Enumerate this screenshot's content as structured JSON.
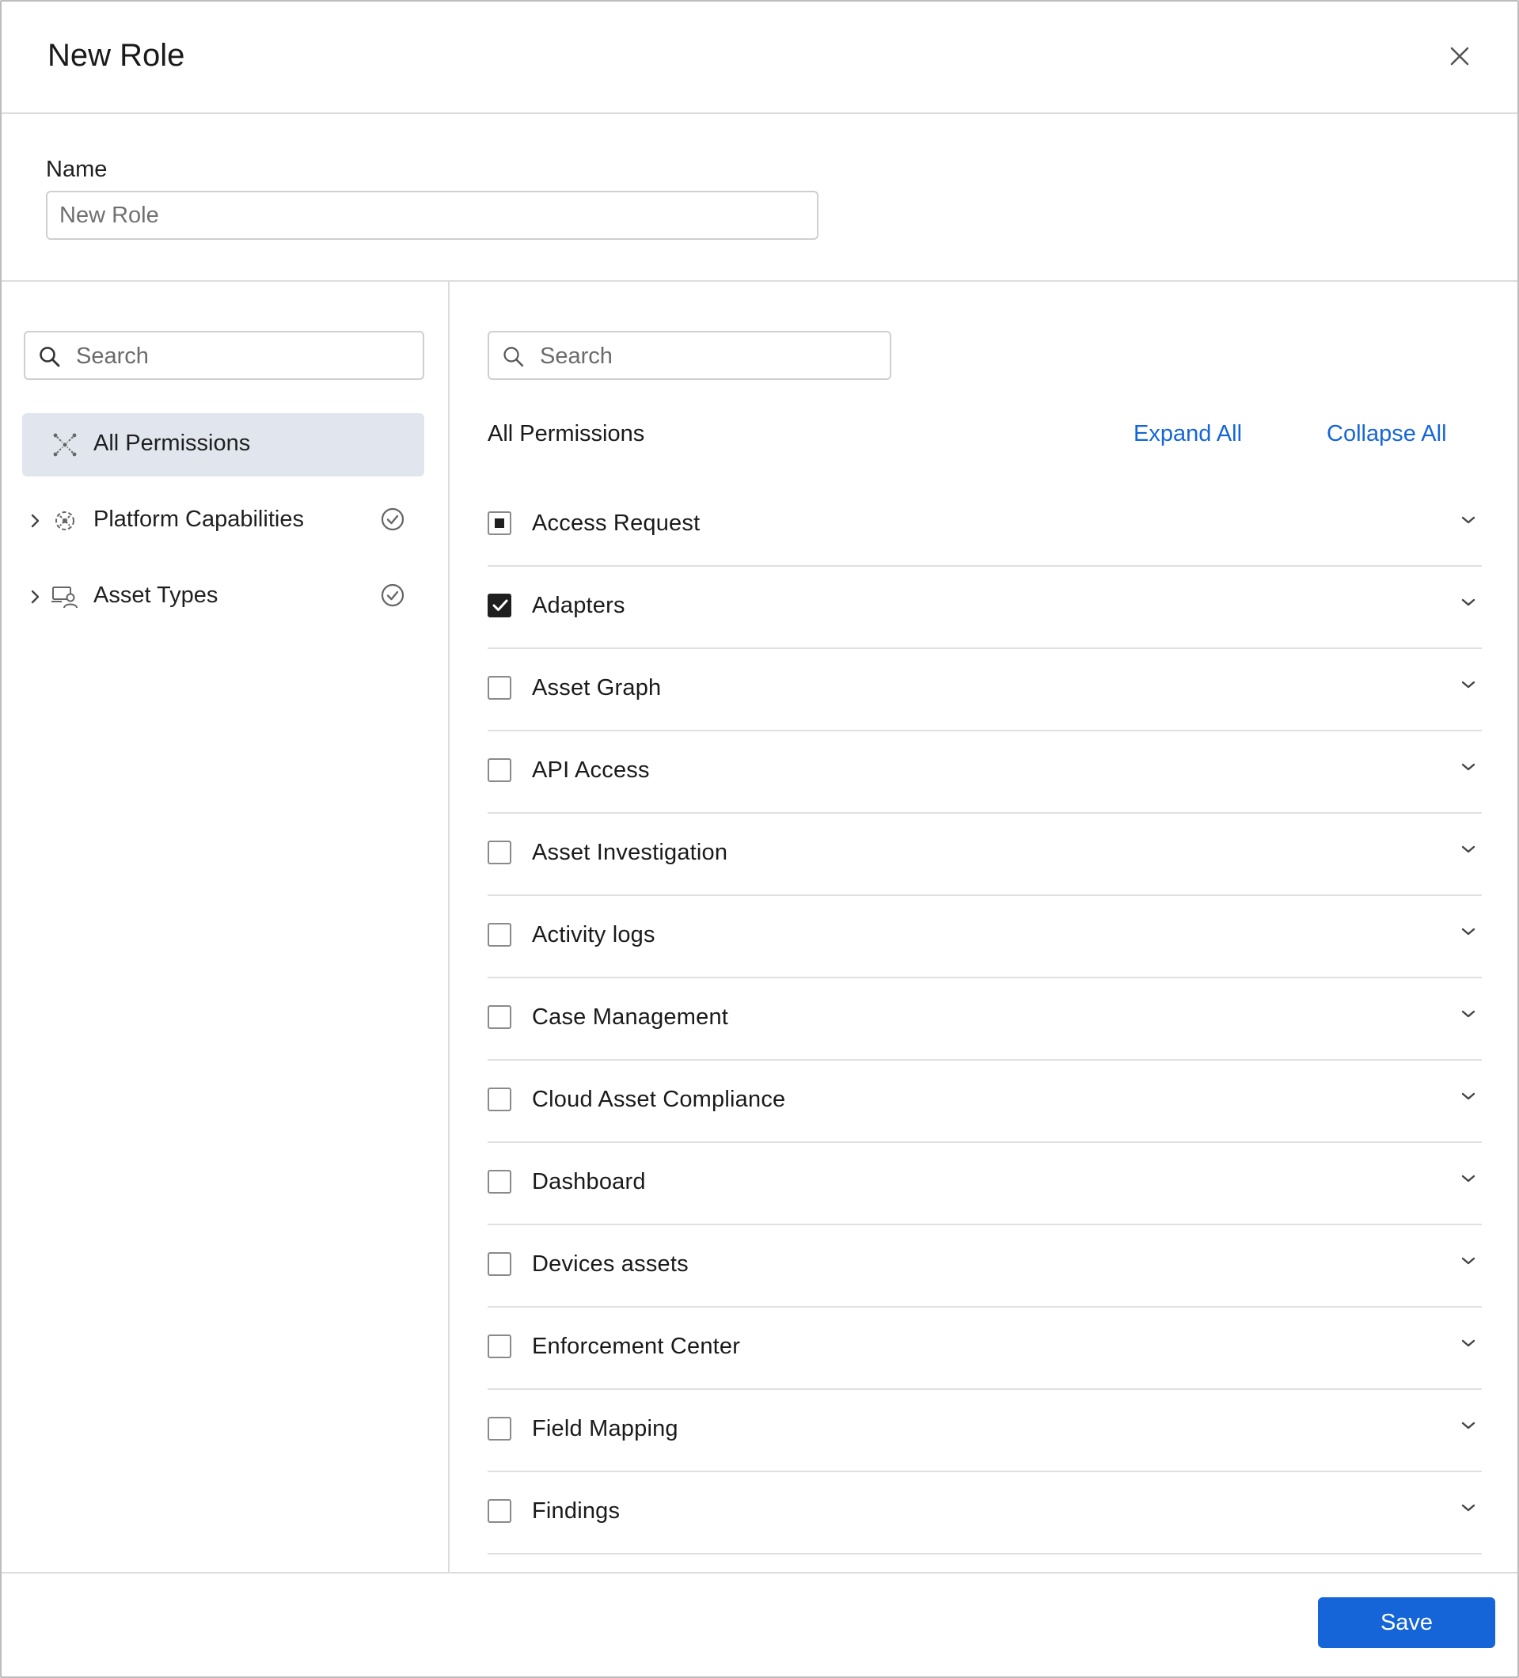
{
  "dialog": {
    "title": "New Role",
    "close_icon": "close-icon"
  },
  "name_field": {
    "label": "Name",
    "placeholder": "New Role",
    "value": ""
  },
  "left_panel": {
    "search_placeholder": "Search",
    "tree": [
      {
        "label": "All Permissions",
        "icon": "all-permissions-icon",
        "selected": true,
        "expandable": false,
        "status_icon": ""
      },
      {
        "label": "Platform Capabilities",
        "icon": "platform-capabilities-icon",
        "selected": false,
        "expandable": true,
        "status_icon": "check-circle-icon"
      },
      {
        "label": "Asset Types",
        "icon": "asset-types-icon",
        "selected": false,
        "expandable": true,
        "status_icon": "check-circle-icon"
      }
    ]
  },
  "right_panel": {
    "search_placeholder": "Search",
    "heading": "All Permissions",
    "expand_all": "Expand All",
    "collapse_all": "Collapse All",
    "permissions": [
      {
        "label": "Access Request",
        "state": "partial"
      },
      {
        "label": "Adapters",
        "state": "checked"
      },
      {
        "label": "Asset Graph",
        "state": "unchecked"
      },
      {
        "label": "API Access",
        "state": "unchecked"
      },
      {
        "label": "Asset Investigation",
        "state": "unchecked"
      },
      {
        "label": "Activity logs",
        "state": "unchecked"
      },
      {
        "label": "Case Management",
        "state": "unchecked"
      },
      {
        "label": "Cloud Asset Compliance",
        "state": "unchecked"
      },
      {
        "label": "Dashboard",
        "state": "unchecked"
      },
      {
        "label": "Devices assets",
        "state": "unchecked"
      },
      {
        "label": "Enforcement Center",
        "state": "unchecked"
      },
      {
        "label": "Field Mapping",
        "state": "unchecked"
      },
      {
        "label": "Findings",
        "state": "unchecked"
      }
    ]
  },
  "footer": {
    "save_label": "Save"
  },
  "colors": {
    "accent": "#1565d8",
    "selected_bg": "#e1e6ee",
    "border": "#dcdcdc"
  }
}
